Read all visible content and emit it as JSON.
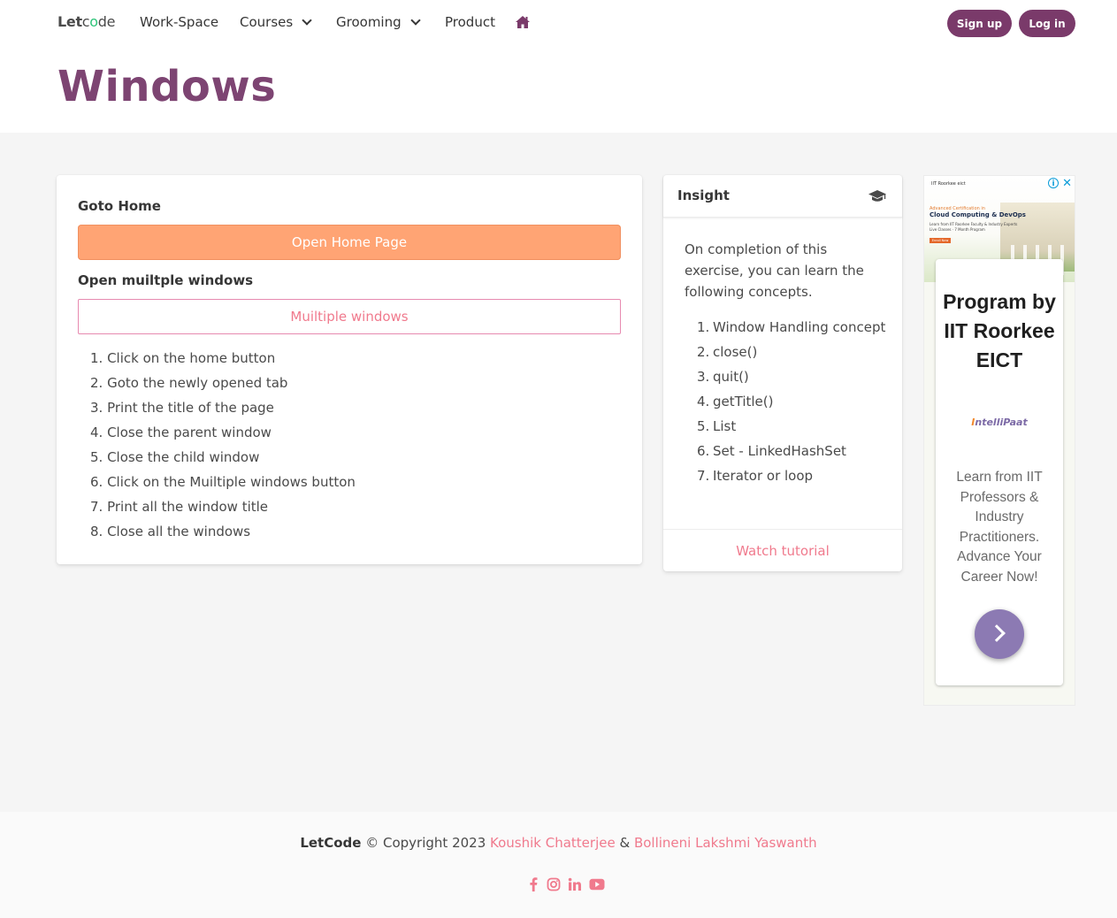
{
  "nav": {
    "brand_let": "Let",
    "brand_c": "c",
    "brand_o": "o",
    "brand_de": "de",
    "items": [
      "Work-Space",
      "Courses",
      "Grooming",
      "Product"
    ],
    "signup": "Sign up",
    "login": "Log in"
  },
  "hero": {
    "title": "Windows"
  },
  "left_card": {
    "goto_home_label": "Goto Home",
    "open_home_button": "Open Home Page",
    "multi_label": "Open muiltple windows",
    "multi_button": "Muiltiple windows",
    "steps": [
      "1. Click on the home button",
      "2. Goto the newly opened tab",
      "3. Print the title of the page",
      "4. Close the parent window",
      "5. Close the child window",
      "6. Click on the Muiltiple windows button",
      "7. Print all the window title",
      "8. Close all the windows"
    ]
  },
  "insight": {
    "title": "Insight",
    "description": "On completion of this exercise, you can learn the following concepts.",
    "concepts": [
      {
        "n": "1.",
        "text": "Window Handling concept"
      },
      {
        "n": "2.",
        "text": "close()"
      },
      {
        "n": "3.",
        "text": "quit()"
      },
      {
        "n": "4.",
        "text": "getTitle()"
      },
      {
        "n": "5.",
        "text": "List"
      },
      {
        "n": "6.",
        "text": "Set - LinkedHashSet"
      },
      {
        "n": "7.",
        "text": "Iterator or loop"
      }
    ],
    "watch": "Watch tutorial"
  },
  "ad": {
    "logo_text": "IIT Roorkee   eict",
    "cert_text": "Advanced Certification in",
    "cloud_text": "Cloud Computing & DevOps",
    "bullets": [
      "Learn from IIT Roorkee Faculty & Industry Experts",
      "Live Classes · 7 Month Program"
    ],
    "enroll": "Enroll Now",
    "headline": "Program by IIT Roorkee EICT",
    "brand_i": "I",
    "brand_rest": "ntelliPaat",
    "sub": "Learn from IIT Professors & Industry Practitioners. Advance Your Career Now!",
    "info": "i",
    "close": "✕"
  },
  "footer": {
    "brand": "LetCode",
    "copyright": " © Copyright 2023 ",
    "author1": "Koushik Chatterjee",
    "amp": " & ",
    "author2": "Bollineni Lakshmi Yaswanth"
  },
  "colors": {
    "accent_purple": "#7d4472",
    "button_orange": "#ffa474",
    "link_pink": "#f07a8d",
    "brand_green": "#2fc47a"
  },
  "icons": [
    "home-icon",
    "graduation-cap-icon",
    "facebook-icon",
    "instagram-icon",
    "linkedin-icon",
    "youtube-icon",
    "chevron-down-icon",
    "chevron-right-icon"
  ]
}
